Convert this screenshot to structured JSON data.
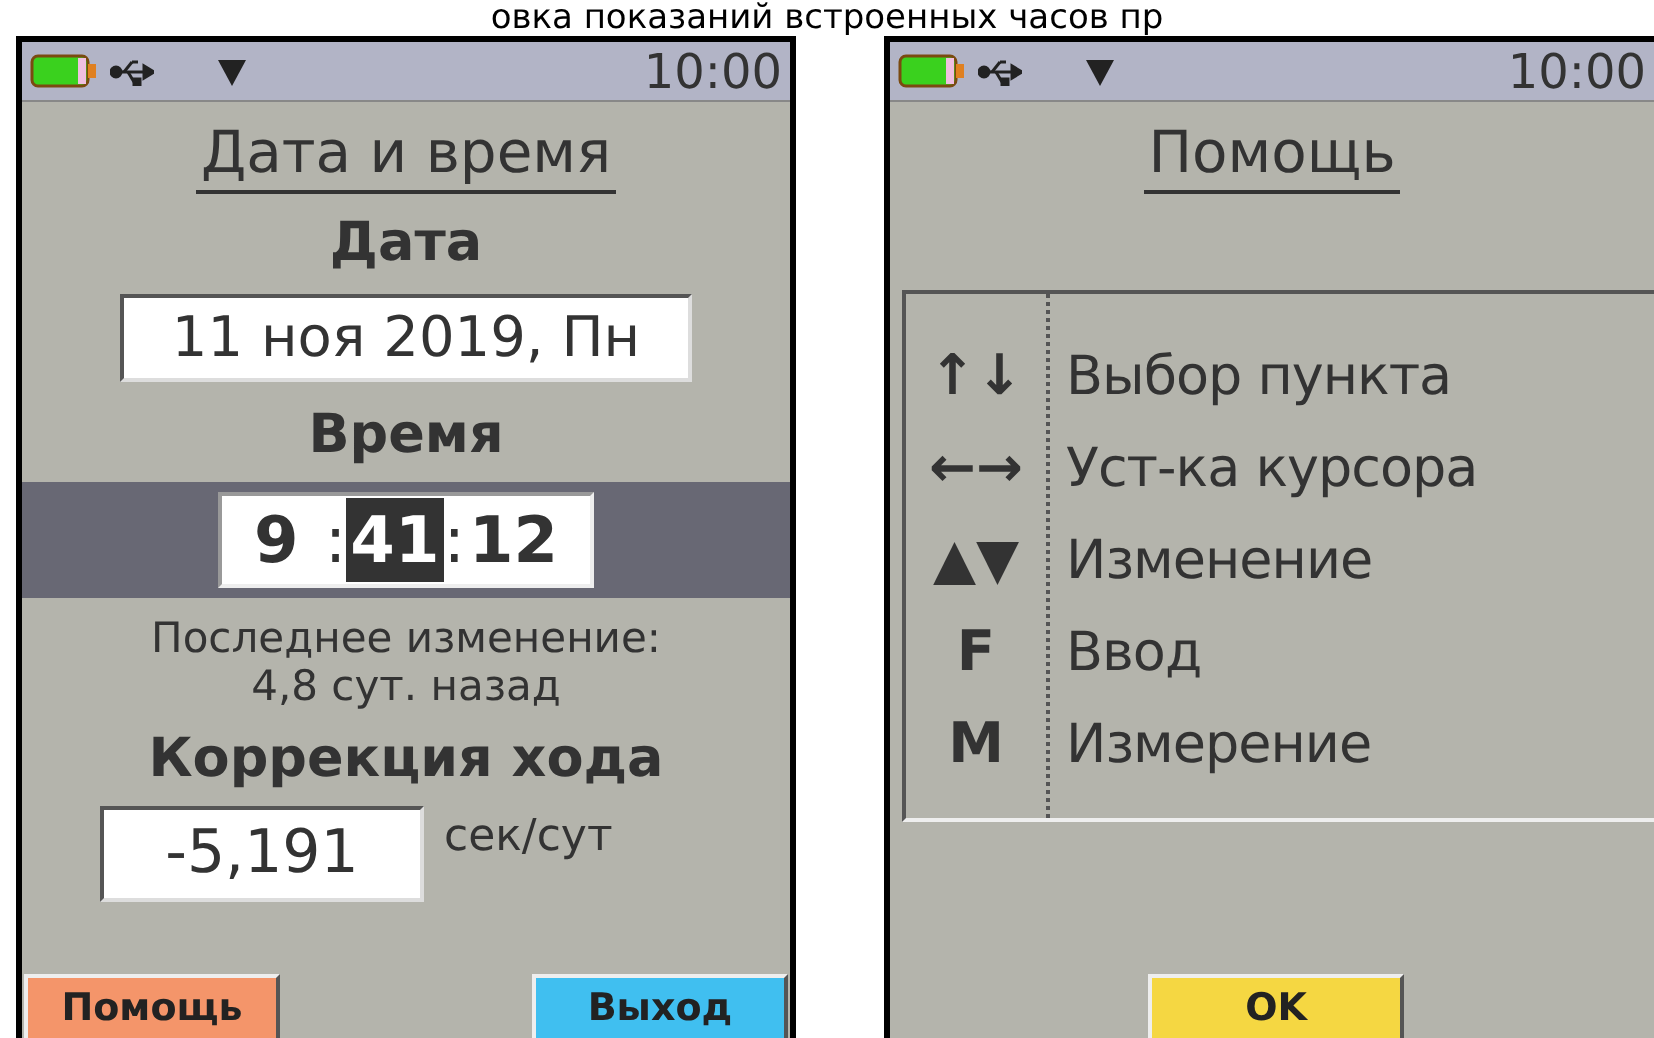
{
  "caption": "овка показаний встроенных часов пр",
  "screens": [
    {
      "kind": "date_time",
      "status_bar": {
        "time": "10:00"
      },
      "title": "Дата и время",
      "date_label": "Дата",
      "date_value": "11 ноя 2019, Пн",
      "time_label": "Время",
      "time_segments": [
        {
          "kind": "digits",
          "text": "9 ",
          "selected": false
        },
        {
          "kind": "sep",
          "text": ":"
        },
        {
          "kind": "digits",
          "text": "41",
          "selected": true
        },
        {
          "kind": "sep",
          "text": ":"
        },
        {
          "kind": "digits",
          "text": "12",
          "selected": false
        }
      ],
      "last_change_label": "Последнее изменение:",
      "last_change_value": "4,8 сут. назад",
      "correction_label": "Коррекция хода",
      "correction_value": "-5,191",
      "correction_unit": "сек/сут",
      "buttons": [
        {
          "label": "Помощь",
          "color": "#f4956a"
        },
        {
          "label": "Выход",
          "color": "#40bff0"
        }
      ]
    },
    {
      "kind": "help",
      "status_bar": {
        "time": "10:00"
      },
      "title": "Помощь",
      "rows": [
        {
          "key": "↑↓",
          "action": "Выбор пункта"
        },
        {
          "key": "←→",
          "action": "Уст-ка курсора"
        },
        {
          "key": "▲▼",
          "action": "Изменение"
        },
        {
          "key": "F",
          "action": "Ввод"
        },
        {
          "key": "M",
          "action": "Измерение"
        }
      ],
      "buttons": [
        {
          "label": "OK",
          "color": "#f5d742"
        }
      ]
    }
  ]
}
